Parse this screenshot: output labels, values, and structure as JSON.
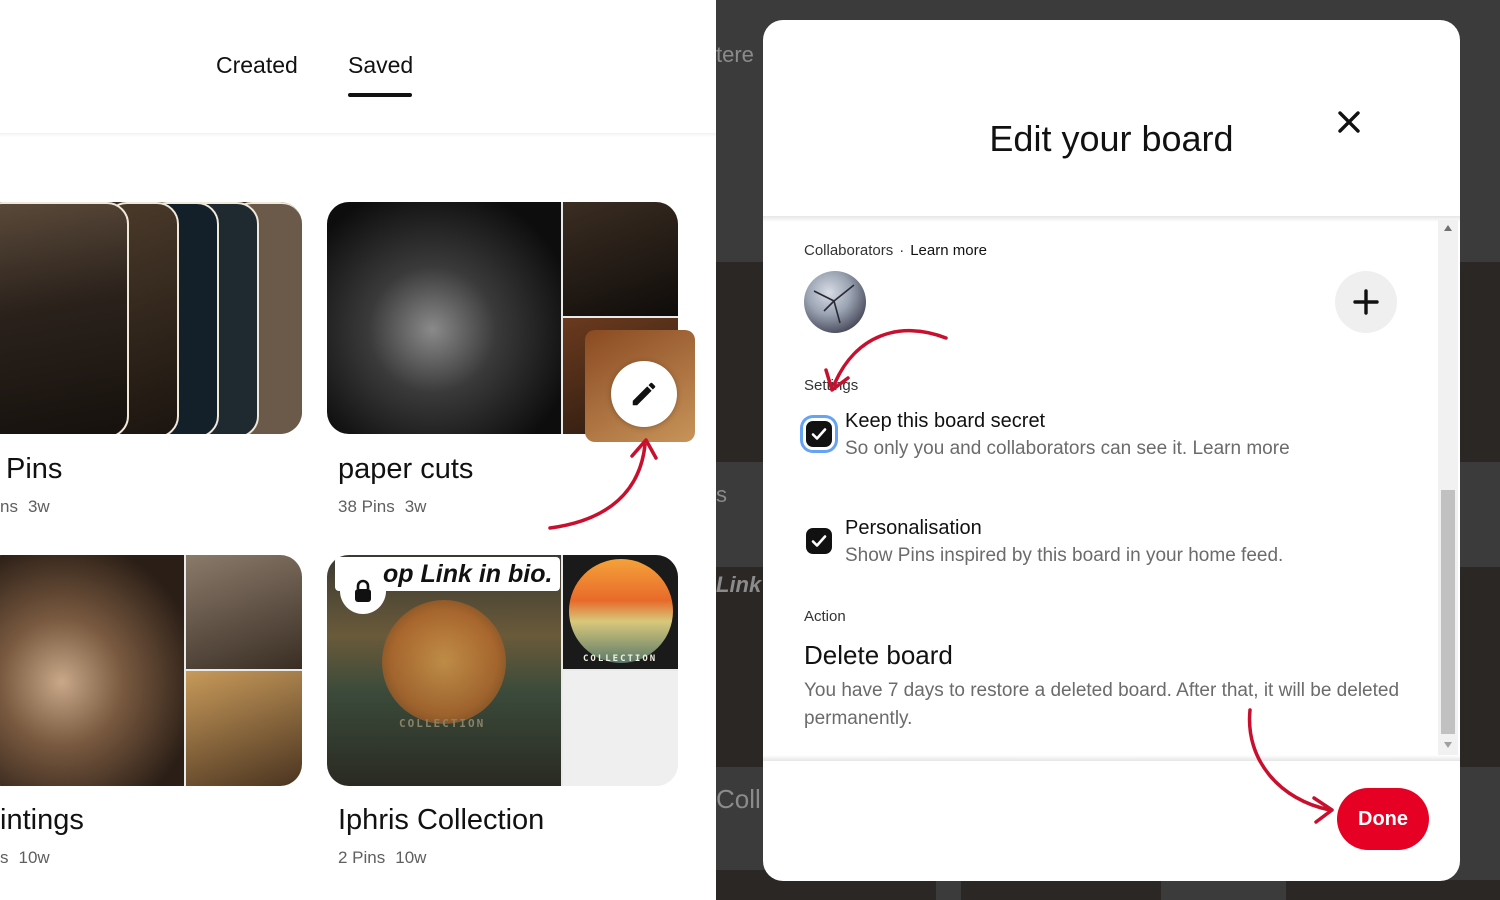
{
  "profile": {
    "tabs": [
      {
        "label": "Created"
      },
      {
        "label": "Saved"
      }
    ],
    "boards": [
      {
        "title": "Pins",
        "pins": "ns",
        "age": "3w"
      },
      {
        "title": "paper cuts",
        "pins": "38 Pins",
        "age": "3w"
      },
      {
        "title": "intings",
        "pins": "s",
        "age": "10w"
      },
      {
        "title": "Iphris Collection",
        "pins": "2 Pins",
        "age": "10w"
      }
    ],
    "overlay_caption": "op Link in bio.",
    "cover_word": "COLLECTION"
  },
  "background_fragments": {
    "top": "tere",
    "middle": "s",
    "link": "Link i",
    "coll": "Coll"
  },
  "modal": {
    "title": "Edit your board",
    "collaborators_label": "Collaborators",
    "collaborators_separator": "·",
    "collaborators_learn_more": "Learn more",
    "settings_label": "Settings",
    "secret": {
      "title": "Keep this board secret",
      "description": "So only you and collaborators can see it. Learn more",
      "checked": true
    },
    "personalisation": {
      "title": "Personalisation",
      "description": "Show Pins inspired by this board in your home feed.",
      "checked": true
    },
    "action_label": "Action",
    "delete_title": "Delete board",
    "delete_description": "You have 7 days to restore a deleted board. After that, it will be deleted permanently.",
    "done_label": "Done"
  },
  "colors": {
    "accent": "#e60023",
    "annotation": "#c8102e",
    "focus_ring": "#66a3f2",
    "dim_background": "#3b3b3b"
  },
  "icons": [
    "close-icon",
    "plus-icon",
    "check-icon",
    "pencil-icon",
    "lock-icon"
  ]
}
